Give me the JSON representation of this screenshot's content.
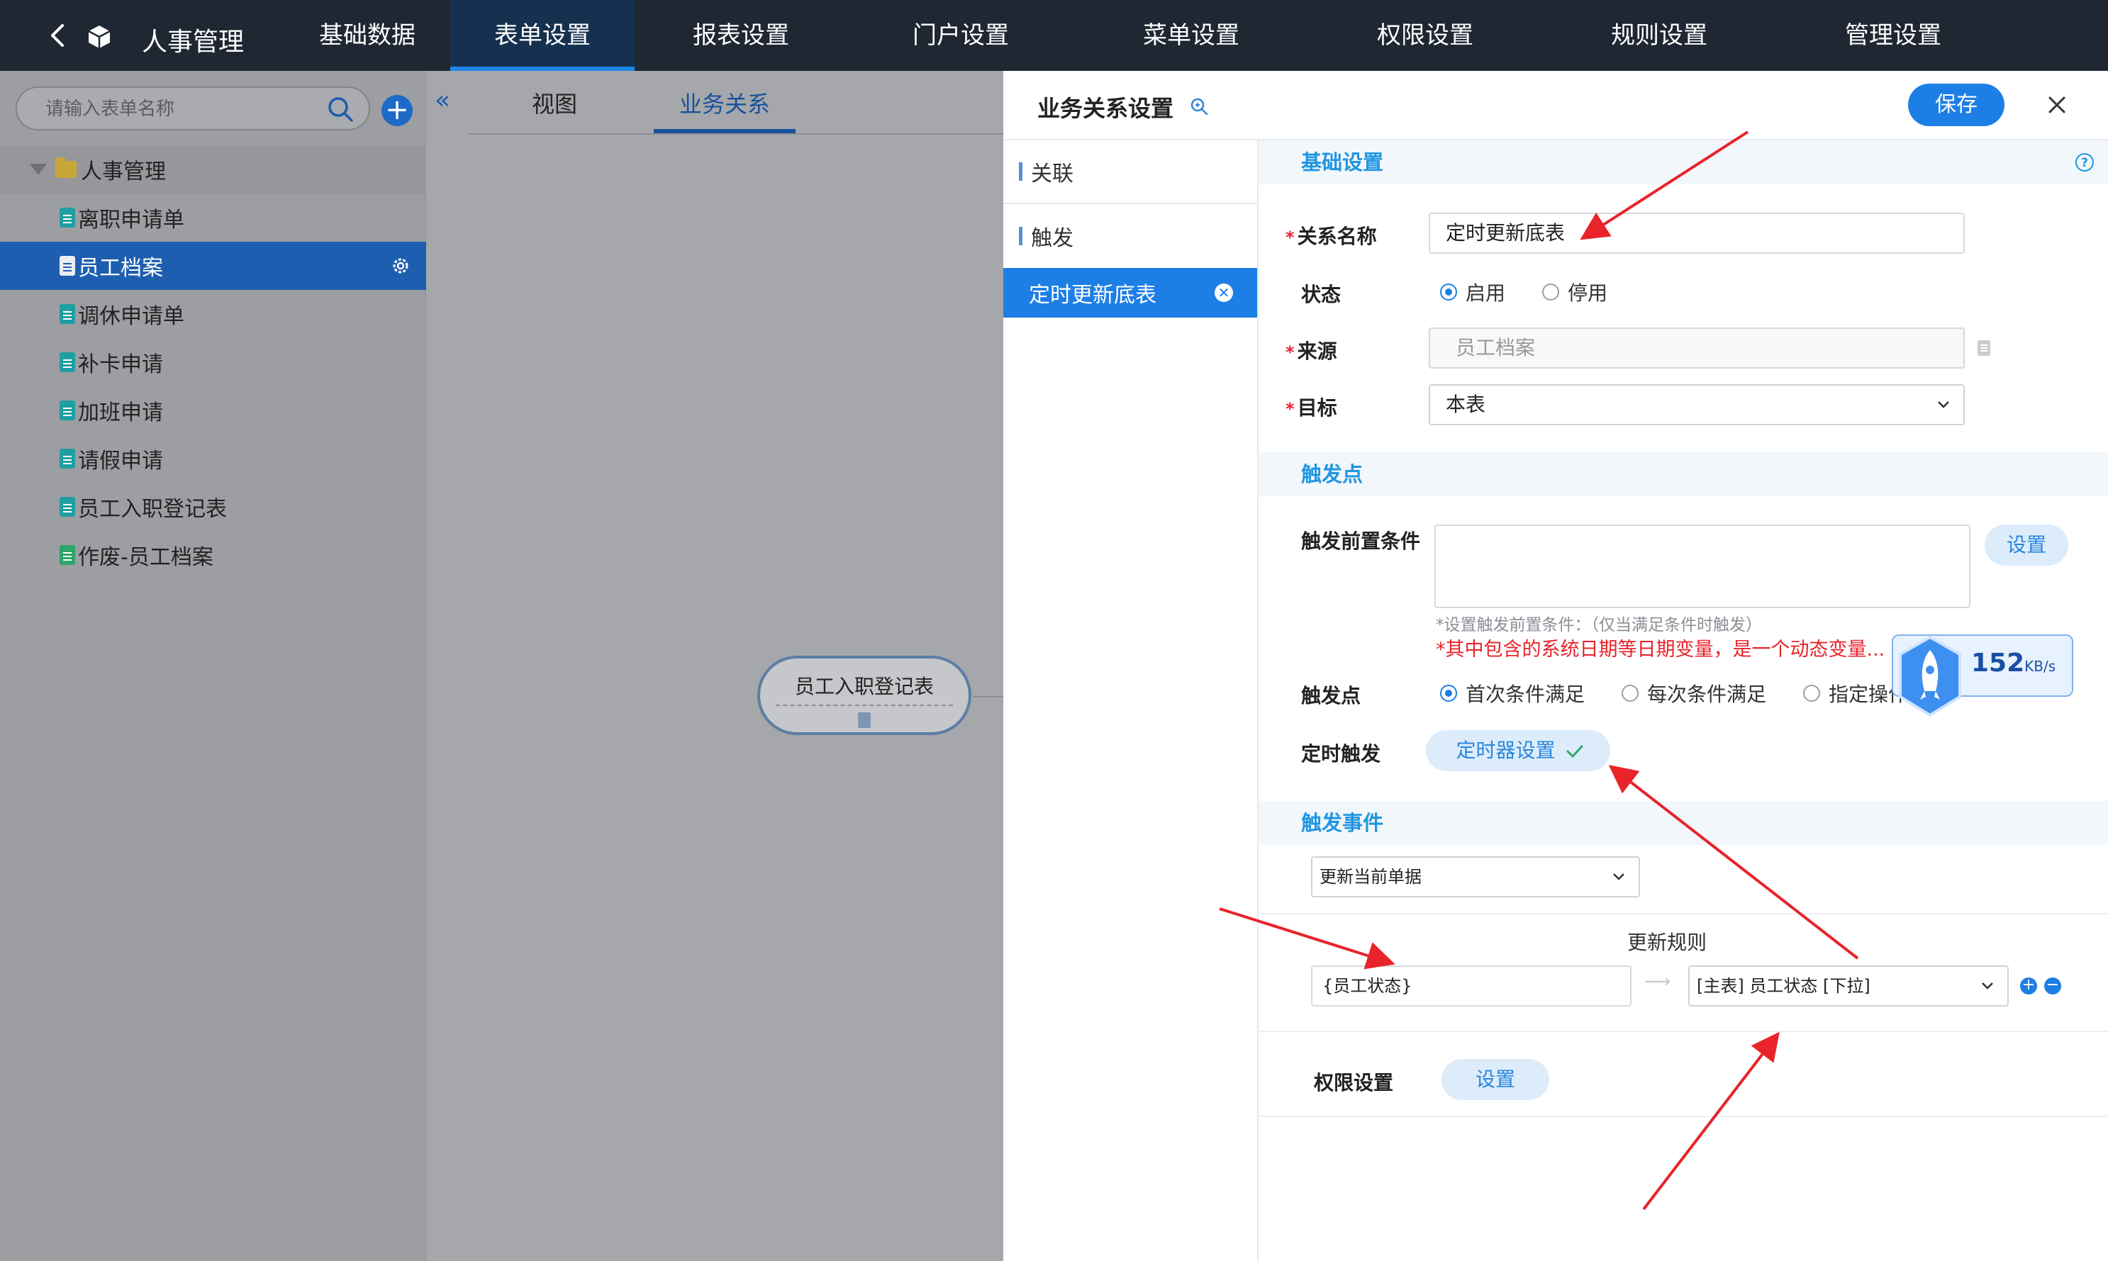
{
  "topbar": {
    "app_title": "人事管理",
    "nav": [
      "基础数据",
      "表单设置",
      "报表设置",
      "门户设置",
      "菜单设置",
      "权限设置",
      "规则设置",
      "管理设置"
    ],
    "active_nav": "表单设置"
  },
  "sidebar": {
    "search_placeholder": "请输入表单名称",
    "root": "人事管理",
    "items": [
      {
        "label": "离职申请单",
        "active": false
      },
      {
        "label": "员工档案",
        "active": true
      },
      {
        "label": "调休申请单",
        "active": false
      },
      {
        "label": "补卡申请",
        "active": false
      },
      {
        "label": "加班申请",
        "active": false
      },
      {
        "label": "请假申请",
        "active": false
      },
      {
        "label": "员工入职登记表",
        "active": false
      },
      {
        "label": "作废-员工档案",
        "active": false
      }
    ]
  },
  "canvas": {
    "tabs": [
      "视图",
      "业务关系"
    ],
    "active_tab": "业务关系",
    "node_label": "员工入职登记表"
  },
  "panel": {
    "title": "业务关系设置",
    "save_label": "保存",
    "subnav": {
      "relation": "关联",
      "trigger": "触发",
      "active_item": "定时更新底表"
    },
    "basic": {
      "section": "基础设置",
      "name_label": "关系名称",
      "name_value": "定时更新底表",
      "status_label": "状态",
      "status_on": "启用",
      "status_off": "停用",
      "source_label": "来源",
      "source_value": "员工档案",
      "target_label": "目标",
      "target_value": "本表"
    },
    "trigger_point": {
      "section": "触发点",
      "precondition_label": "触发前置条件",
      "set_label": "设置",
      "hint": "*设置触发前置条件：（仅当满足条件时触发）",
      "warning": "*其中包含的系统日期等日期变量，是一个动态变量...",
      "point_label": "触发点",
      "opt1": "首次条件满足",
      "opt2": "每次条件满足",
      "opt3": "指定操作",
      "timer_label": "定时触发",
      "timer_button": "定时器设置"
    },
    "trigger_event": {
      "section": "触发事件",
      "event_value": "更新当前单据",
      "rule_title": "更新规则",
      "rule_left": "{员工状态}",
      "rule_right": "[主表] 员工状态 [下拉]"
    },
    "permission": {
      "label": "权限设置",
      "button": "设置"
    }
  },
  "speed_widget": {
    "value": "152",
    "unit": "KB/s"
  },
  "colors": {
    "topbar": "#1f2733",
    "accent": "#1d7ee6",
    "section_text": "#2196e0",
    "annotation": "#e8232a"
  }
}
